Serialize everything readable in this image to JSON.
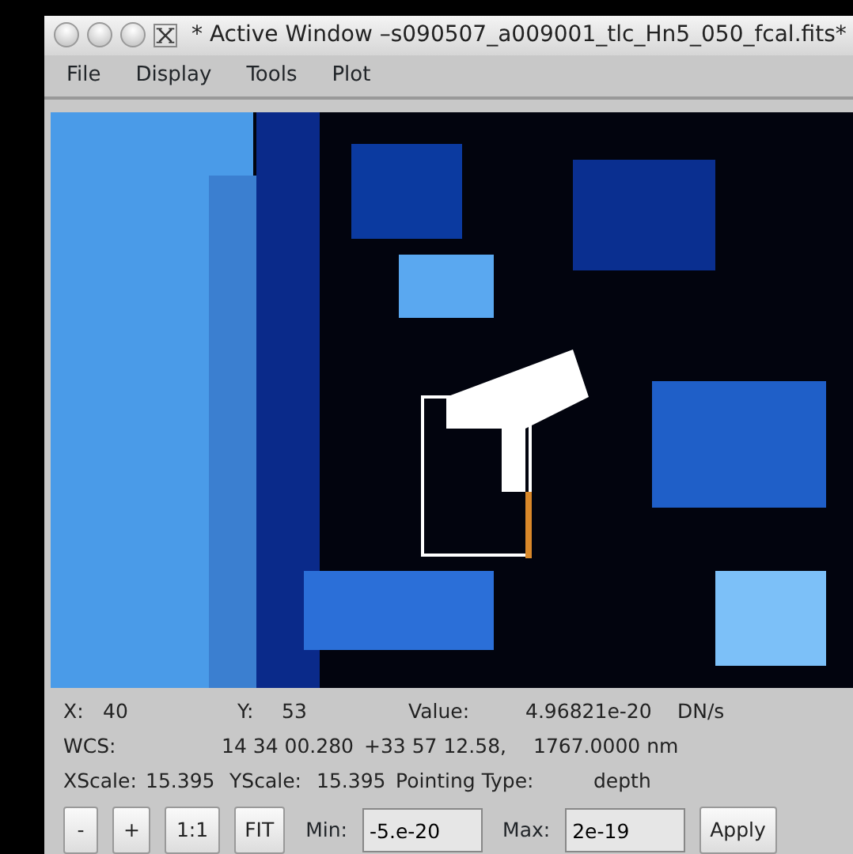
{
  "window": {
    "title": "* Active Window –s090507_a009001_tlc_Hn5_050_fcal.fits*"
  },
  "menu": [
    "File",
    "Display",
    "Tools",
    "Plot"
  ],
  "image": {
    "kind": "picture"
  },
  "info_rows": [
    [
      "X:",
      "40",
      "Y:",
      "53",
      "Value:",
      "4.96821e-20",
      "DN/s"
    ],
    [
      "WCS:",
      "14 34 00.280",
      "+33 57 12.58,",
      "1767.0000 nm"
    ],
    [
      "XScale:",
      "15.395",
      "YScale:",
      "15.395",
      "Pointing Type:",
      "depth"
    ]
  ],
  "controls": [
    {
      "kind": "button",
      "label": "-"
    },
    {
      "kind": "button",
      "label": "+"
    },
    {
      "kind": "button",
      "label": "1:1"
    },
    {
      "kind": "button",
      "label": "FIT"
    },
    {
      "kind": "field",
      "label": "Min:",
      "value": "-5.e-20"
    },
    {
      "kind": "field",
      "label": "Max:",
      "value": "2e-19"
    },
    {
      "kind": "button",
      "label": "Apply"
    }
  ]
}
